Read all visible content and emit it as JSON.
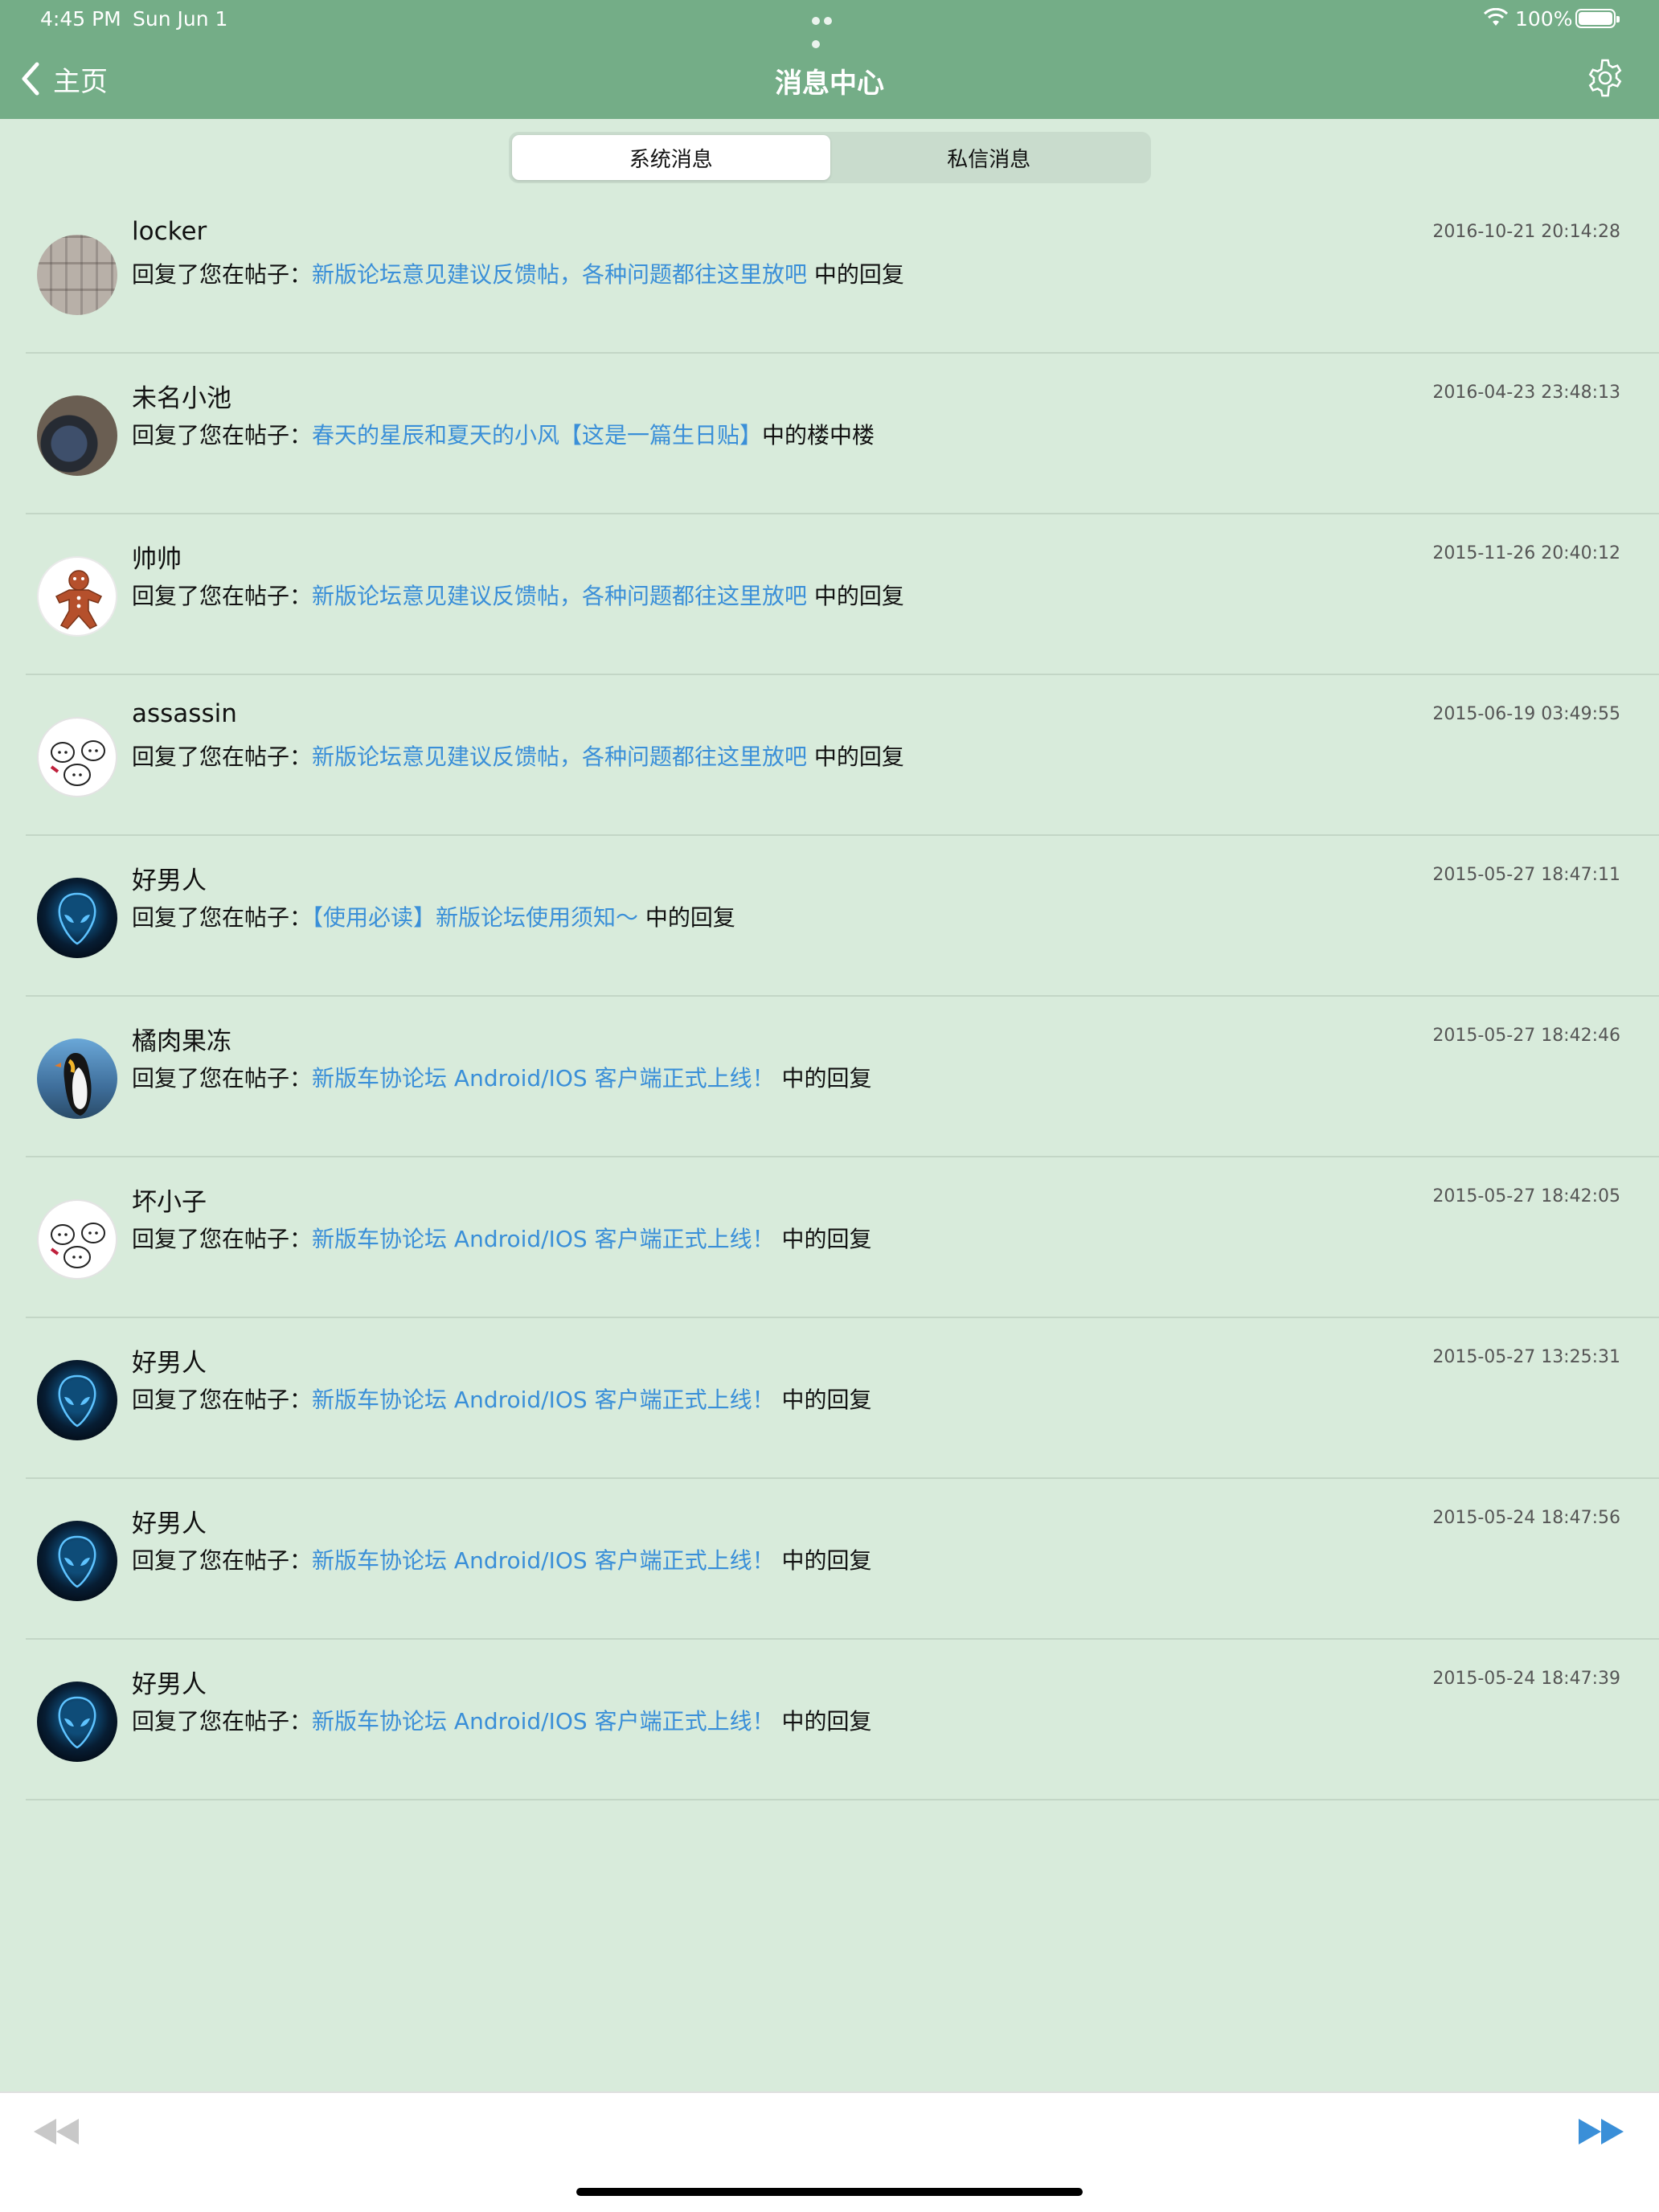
{
  "status": {
    "time": "4:45 PM",
    "date": "Sun Jun 1",
    "battery": "100%"
  },
  "nav": {
    "back_label": "主页",
    "title": "消息中心"
  },
  "tabs": [
    {
      "label": "系统消息",
      "active": true
    },
    {
      "label": "私信消息",
      "active": false
    }
  ],
  "messages": [
    {
      "user": "locker",
      "time": "2016-10-21 20:14:28",
      "prefix": "回复了您在帖子：",
      "post": "新版论坛意见建议反馈帖，各种问题都往这里放吧",
      "suffix": " 中的回复",
      "avatar": "locker-photo"
    },
    {
      "user": "未名小池",
      "time": "2016-04-23 23:48:13",
      "prefix": "回复了您在帖子：",
      "post": "春天的星辰和夏天的小风【这是一篇生日贴】",
      "suffix": "中的楼中楼",
      "avatar": "street-photo"
    },
    {
      "user": "帅帅",
      "time": "2015-11-26 20:40:12",
      "prefix": "回复了您在帖子：",
      "post": "新版论坛意见建议反馈帖，各种问题都往这里放吧",
      "suffix": " 中的回复",
      "avatar": "gingerbread"
    },
    {
      "user": "assassin",
      "time": "2015-06-19 03:49:55",
      "prefix": "回复了您在帖子：",
      "post": "新版论坛意见建议反馈帖，各种问题都往这里放吧",
      "suffix": " 中的回复",
      "avatar": "cartoon-cats"
    },
    {
      "user": "好男人",
      "time": "2015-05-27 18:47:11",
      "prefix": "回复了您在帖子：",
      "post": "【使用必读】新版论坛使用须知～",
      "suffix": " 中的回复",
      "avatar": "alien-logo"
    },
    {
      "user": "橘肉果冻",
      "time": "2015-05-27 18:42:46",
      "prefix": "回复了您在帖子：",
      "post": "新版车协论坛 Android/IOS 客户端正式上线！",
      "suffix": " 中的回复",
      "avatar": "penguin"
    },
    {
      "user": "坏小子",
      "time": "2015-05-27 18:42:05",
      "prefix": "回复了您在帖子：",
      "post": "新版车协论坛 Android/IOS 客户端正式上线！",
      "suffix": " 中的回复",
      "avatar": "cartoon-cats"
    },
    {
      "user": "好男人",
      "time": "2015-05-27 13:25:31",
      "prefix": "回复了您在帖子：",
      "post": "新版车协论坛 Android/IOS 客户端正式上线！",
      "suffix": " 中的回复",
      "avatar": "alien-logo"
    },
    {
      "user": "好男人",
      "time": "2015-05-24 18:47:56",
      "prefix": "回复了您在帖子：",
      "post": "新版车协论坛 Android/IOS 客户端正式上线！",
      "suffix": " 中的回复",
      "avatar": "alien-logo"
    },
    {
      "user": "好男人",
      "time": "2015-05-24 18:47:39",
      "prefix": "回复了您在帖子：",
      "post": "新版车协论坛 Android/IOS 客户端正式上线！",
      "suffix": " 中的回复",
      "avatar": "alien-logo"
    }
  ],
  "toolbar": {
    "prev_icon": "rewind-icon",
    "next_icon": "fast-forward-icon",
    "prev_color": "#c8c8c8",
    "next_color": "#3a8fd8"
  },
  "colors": {
    "nav": "#74ad87",
    "background": "#d8ebdb",
    "link": "#3a8fd8"
  }
}
